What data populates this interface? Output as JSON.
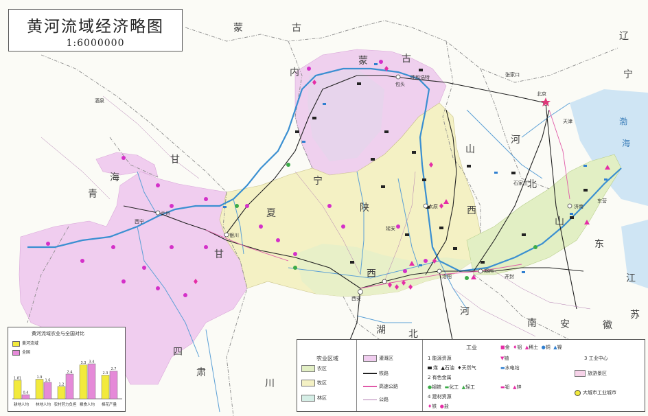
{
  "title": "黄河流域经济略图",
  "scale": "1:6000000",
  "regions": {
    "mongolia": "蒙",
    "gu": "古",
    "nei": "内",
    "meng2": "蒙",
    "gu2": "古",
    "liao": "辽",
    "ning_liaoning": "宁",
    "gan": "甘",
    "su": "肃",
    "hai": "海",
    "qing": "青",
    "ning": "宁",
    "xia": "夏",
    "shan1": "陕",
    "xi1": "西",
    "shan2": "山",
    "xi2": "西",
    "he1": "河",
    "bei1": "北",
    "shandong1": "山",
    "shandong2": "东",
    "henan1": "河",
    "henan2": "南",
    "hubei1": "湖",
    "hubei2": "北",
    "si": "四",
    "chuan": "川",
    "an": "安",
    "hui": "徽",
    "jiang": "江",
    "su2": "苏",
    "gan2": "甘",
    "su3": "肃"
  },
  "cities": {
    "beijing": "北京",
    "tianjin": "天津",
    "lanzhou": "兰州",
    "xining": "西宁",
    "yinchuan": "银川",
    "xian": "西安",
    "taiyuan": "太原",
    "zhengzhou": "郑州",
    "jinan": "济南",
    "baotou": "包头",
    "huhehaote": "呼和浩特",
    "luoyang": "洛阳",
    "kaifeng": "开封",
    "shijiazhuang": "石家庄",
    "yanan": "延安",
    "dongying": "东营",
    "jiuquan": "酒泉",
    "zhangjiakou": "张家口"
  },
  "sea_labels": {
    "bohai": "渤",
    "hai": "海"
  },
  "inset": {
    "title": "黄河流域农业与全国对比",
    "legend": [
      {
        "label": "黄河流域",
        "color": "#f2ea3c"
      },
      {
        "label": "全国",
        "color": "#e58ad8"
      }
    ],
    "chart_data": {
      "type": "bar",
      "categories": [
        "耕地人均",
        "林地人均",
        "农村劳力负担",
        "粮食人均",
        "棉花产量"
      ],
      "series": [
        {
          "name": "黄河流域",
          "values": [
            1.8,
            1.9,
            1.2,
            3.3,
            2.3
          ]
        },
        {
          "name": "全国",
          "values": [
            0.4,
            1.6,
            2.4,
            3.4,
            2.7
          ]
        }
      ],
      "data_labels": [
        [
          "1.81",
          "0.4"
        ],
        [
          "1.9",
          "1.6"
        ],
        [
          "1.2",
          "2.4"
        ],
        [
          "3.3",
          "3.4"
        ],
        [
          "2.3",
          "2.7"
        ]
      ],
      "ylim": [
        0,
        4
      ]
    }
  },
  "legend": {
    "section1_title": "农业区域",
    "farming": "农区",
    "pastoral": "牧区",
    "forest": "林区",
    "irrigated": "灌溉区",
    "railway": "铁路",
    "highway": "高速公路",
    "road": "公路",
    "section2_title": "工业",
    "energy": "1 能源资源",
    "coal": "煤",
    "oil": "石油",
    "gas": "天然气",
    "hydro": "水电站",
    "metal": "2 有色金属",
    "steel": "钢铁",
    "chem": "化工",
    "light": "轻工",
    "industrial_center": "3 工业中心",
    "metal_resources": "铁",
    "gold": "金",
    "aluminum": "铝",
    "uranium": "铀",
    "rare": "稀土",
    "copper": "铜",
    "nickel": "镍",
    "lead": "铅",
    "zinc": "锌",
    "salt": "盐",
    "material_resources": "4 建材资源",
    "city_legend": "大城市工业城市",
    "scenic": "旅游景区"
  },
  "colors": {
    "pastoral_pink": "#f0cdef",
    "farm_yellow": "#f4f1c4",
    "farm_green": "#e2efc4",
    "sea_blue": "#cfe5f4",
    "river_blue": "#3a8fd1",
    "border_gray": "#8a8a8a",
    "railway": "#222222",
    "highway_pink": "#e05aa8"
  }
}
